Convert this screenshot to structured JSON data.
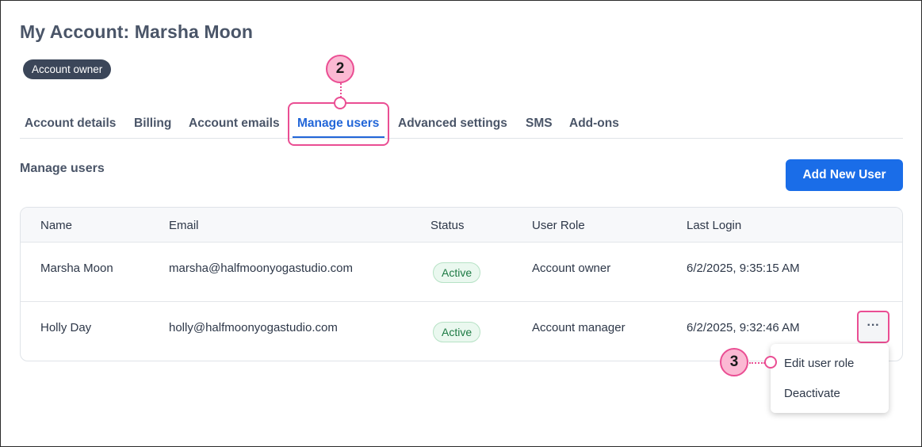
{
  "page": {
    "title": "My Account: Marsha Moon",
    "role_badge": "Account owner"
  },
  "tabs": [
    "Account details",
    "Billing",
    "Account emails",
    "Manage users",
    "Advanced settings",
    "SMS",
    "Add-ons"
  ],
  "active_tab": "Manage users",
  "section": {
    "title": "Manage users",
    "add_button": "Add New User"
  },
  "table": {
    "headers": [
      "Name",
      "Email",
      "Status",
      "User Role",
      "Last Login"
    ],
    "rows": [
      {
        "name": "Marsha Moon",
        "email": "marsha@halfmoonyogastudio.com",
        "status": "Active",
        "role": "Account owner",
        "last_login": "6/2/2025, 9:35:15 AM"
      },
      {
        "name": "Holly Day",
        "email": "holly@halfmoonyogastudio.com",
        "status": "Active",
        "role": "Account manager",
        "last_login": "6/2/2025, 9:32:46 AM"
      }
    ]
  },
  "row_menu": {
    "more_icon": "ellipsis-icon",
    "more_glyph": "···",
    "items": [
      "Edit user role",
      "Deactivate"
    ]
  },
  "callouts": [
    "2",
    "3"
  ],
  "colors": {
    "accent": "#1a6de8",
    "callout_border": "#ea4e93",
    "callout_fill": "#fbb9d3",
    "badge": "#3b4659",
    "status_text": "#1c7a43"
  }
}
